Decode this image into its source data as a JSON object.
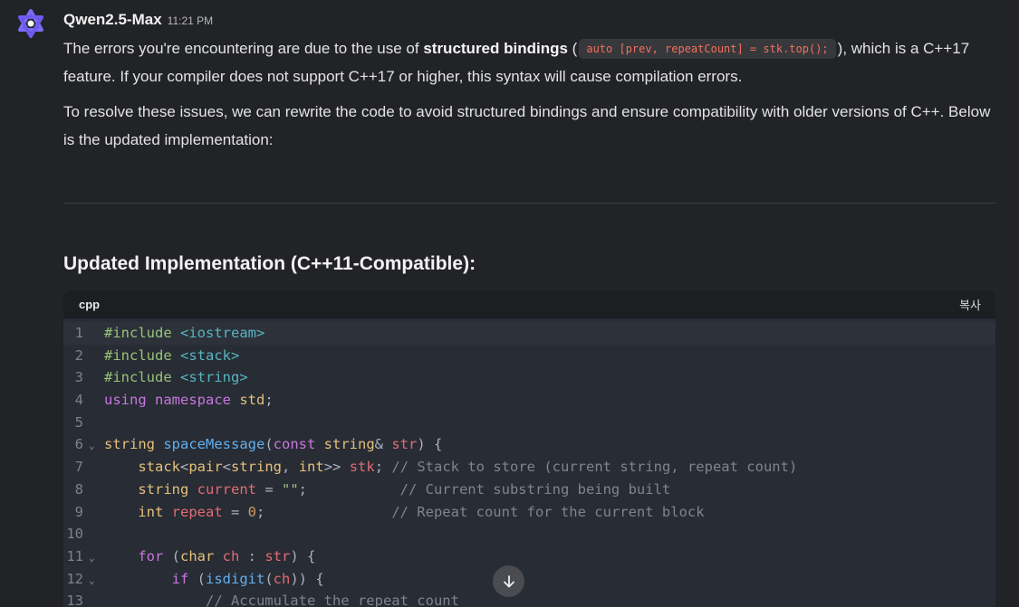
{
  "message": {
    "model_name": "Qwen2.5-Max",
    "timestamp": "11:21 PM",
    "paragraph1": {
      "text_before": "The errors you're encountering are due to the use of ",
      "bold": "structured bindings",
      "text_after_bold": " (",
      "inline_code": "auto [prev, repeatCount] = stk.top();",
      "text_end": "), which is a C++17 feature. If your compiler does not support C++17 or higher, this syntax will cause compilation errors."
    },
    "paragraph2": "To resolve these issues, we can rewrite the code to avoid structured bindings and ensure compatibility with older versions of C++. Below is the updated implementation:",
    "section_heading": "Updated Implementation (C++11-Compatible):"
  },
  "code_block": {
    "language": "cpp",
    "copy_label": "복사",
    "lines": [
      {
        "n": "1",
        "fold": false,
        "tokens": [
          [
            "pre",
            "#include "
          ],
          [
            "inc",
            "<iostream>"
          ]
        ]
      },
      {
        "n": "2",
        "fold": false,
        "tokens": [
          [
            "pre",
            "#include "
          ],
          [
            "inc",
            "<stack>"
          ]
        ]
      },
      {
        "n": "3",
        "fold": false,
        "tokens": [
          [
            "pre",
            "#include "
          ],
          [
            "inc",
            "<string>"
          ]
        ]
      },
      {
        "n": "4",
        "fold": false,
        "tokens": [
          [
            "kw",
            "using namespace "
          ],
          [
            "type",
            "std"
          ],
          [
            "pun",
            ";"
          ]
        ]
      },
      {
        "n": "5",
        "fold": false,
        "tokens": []
      },
      {
        "n": "6",
        "fold": true,
        "tokens": [
          [
            "type",
            "string "
          ],
          [
            "fn",
            "spaceMessage"
          ],
          [
            "pun",
            "("
          ],
          [
            "kw",
            "const "
          ],
          [
            "type",
            "string"
          ],
          [
            "pun",
            "& "
          ],
          [
            "var",
            "str"
          ],
          [
            "pun",
            ") {"
          ]
        ]
      },
      {
        "n": "7",
        "fold": false,
        "tokens": [
          [
            "pun",
            "    "
          ],
          [
            "type",
            "stack"
          ],
          [
            "pun",
            "<"
          ],
          [
            "type",
            "pair"
          ],
          [
            "pun",
            "<"
          ],
          [
            "type",
            "string"
          ],
          [
            "pun",
            ", "
          ],
          [
            "type",
            "int"
          ],
          [
            "pun",
            ">> "
          ],
          [
            "var",
            "stk"
          ],
          [
            "pun",
            "; "
          ],
          [
            "com",
            "// Stack to store (current string, repeat count)"
          ]
        ]
      },
      {
        "n": "8",
        "fold": false,
        "tokens": [
          [
            "pun",
            "    "
          ],
          [
            "type",
            "string "
          ],
          [
            "var",
            "current"
          ],
          [
            "pun",
            " = "
          ],
          [
            "str",
            "\"\""
          ],
          [
            "pun",
            ";           "
          ],
          [
            "com",
            "// Current substring being built"
          ]
        ]
      },
      {
        "n": "9",
        "fold": false,
        "tokens": [
          [
            "pun",
            "    "
          ],
          [
            "type",
            "int "
          ],
          [
            "var",
            "repeat"
          ],
          [
            "pun",
            " = "
          ],
          [
            "num",
            "0"
          ],
          [
            "pun",
            ";               "
          ],
          [
            "com",
            "// Repeat count for the current block"
          ]
        ]
      },
      {
        "n": "10",
        "fold": false,
        "tokens": []
      },
      {
        "n": "11",
        "fold": true,
        "tokens": [
          [
            "pun",
            "    "
          ],
          [
            "kw",
            "for "
          ],
          [
            "pun",
            "("
          ],
          [
            "type",
            "char "
          ],
          [
            "var",
            "ch"
          ],
          [
            "pun",
            " : "
          ],
          [
            "var",
            "str"
          ],
          [
            "pun",
            ") {"
          ]
        ]
      },
      {
        "n": "12",
        "fold": true,
        "tokens": [
          [
            "pun",
            "        "
          ],
          [
            "kw",
            "if "
          ],
          [
            "pun",
            "("
          ],
          [
            "fn",
            "isdigit"
          ],
          [
            "pun",
            "("
          ],
          [
            "var",
            "ch"
          ],
          [
            "pun",
            ")) {"
          ]
        ]
      },
      {
        "n": "13",
        "fold": false,
        "tokens": [
          [
            "pun",
            "            "
          ],
          [
            "com",
            "// Accumulate the repeat count"
          ]
        ]
      }
    ]
  },
  "colors": {
    "background": "#222326",
    "code_background": "#282c34",
    "inline_code_text": "#f2705c"
  }
}
